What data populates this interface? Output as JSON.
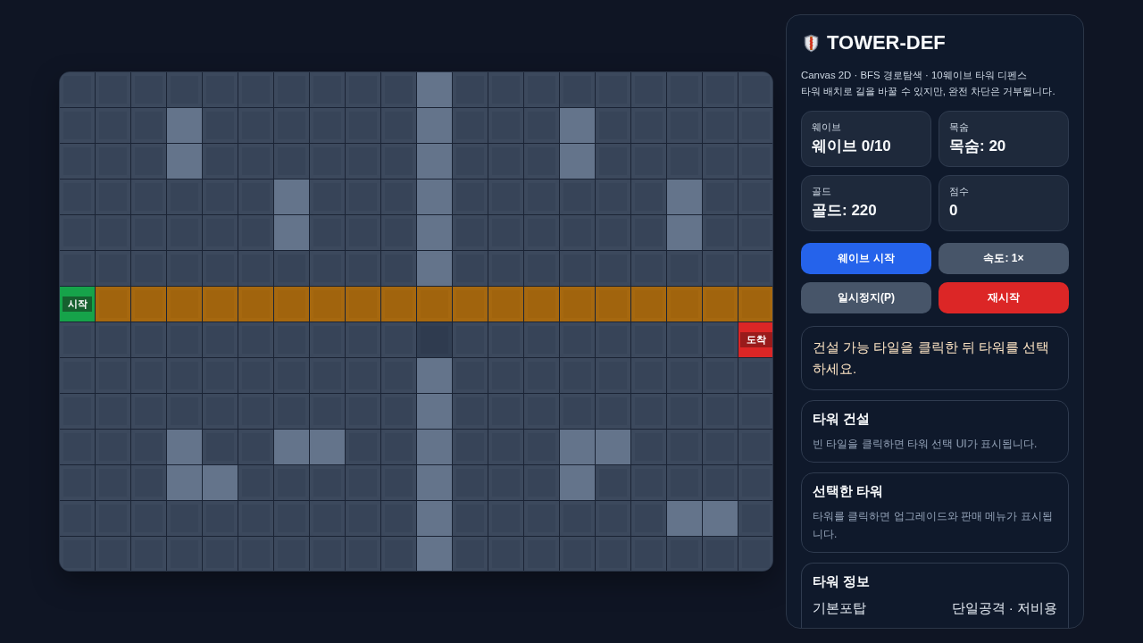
{
  "board": {
    "rows": [
      {
        "tiles": [
          {
            "kind": "floor"
          },
          {
            "kind": "floor"
          },
          {
            "kind": "floor"
          },
          {
            "kind": "floor"
          },
          {
            "kind": "floor"
          },
          {
            "kind": "floor"
          },
          {
            "kind": "floor"
          },
          {
            "kind": "floor"
          },
          {
            "kind": "floor"
          },
          {
            "kind": "floor"
          },
          {
            "kind": "wall"
          },
          {
            "kind": "floor"
          },
          {
            "kind": "floor"
          },
          {
            "kind": "floor"
          },
          {
            "kind": "floor"
          },
          {
            "kind": "floor"
          },
          {
            "kind": "floor"
          },
          {
            "kind": "floor"
          },
          {
            "kind": "floor"
          },
          {
            "kind": "floor"
          }
        ]
      },
      {
        "tiles": [
          {
            "kind": "floor"
          },
          {
            "kind": "floor"
          },
          {
            "kind": "floor"
          },
          {
            "kind": "wall"
          },
          {
            "kind": "floor"
          },
          {
            "kind": "floor"
          },
          {
            "kind": "floor"
          },
          {
            "kind": "floor"
          },
          {
            "kind": "floor"
          },
          {
            "kind": "floor"
          },
          {
            "kind": "wall"
          },
          {
            "kind": "floor"
          },
          {
            "kind": "floor"
          },
          {
            "kind": "floor"
          },
          {
            "kind": "wall"
          },
          {
            "kind": "floor"
          },
          {
            "kind": "floor"
          },
          {
            "kind": "floor"
          },
          {
            "kind": "floor"
          },
          {
            "kind": "floor"
          }
        ]
      },
      {
        "tiles": [
          {
            "kind": "floor"
          },
          {
            "kind": "floor"
          },
          {
            "kind": "floor"
          },
          {
            "kind": "wall"
          },
          {
            "kind": "floor"
          },
          {
            "kind": "floor"
          },
          {
            "kind": "floor"
          },
          {
            "kind": "floor"
          },
          {
            "kind": "floor"
          },
          {
            "kind": "floor"
          },
          {
            "kind": "wall"
          },
          {
            "kind": "floor"
          },
          {
            "kind": "floor"
          },
          {
            "kind": "floor"
          },
          {
            "kind": "wall"
          },
          {
            "kind": "floor"
          },
          {
            "kind": "floor"
          },
          {
            "kind": "floor"
          },
          {
            "kind": "floor"
          },
          {
            "kind": "floor"
          }
        ]
      },
      {
        "tiles": [
          {
            "kind": "floor"
          },
          {
            "kind": "floor"
          },
          {
            "kind": "floor"
          },
          {
            "kind": "floor"
          },
          {
            "kind": "floor"
          },
          {
            "kind": "floor"
          },
          {
            "kind": "wall"
          },
          {
            "kind": "floor"
          },
          {
            "kind": "floor"
          },
          {
            "kind": "floor"
          },
          {
            "kind": "wall"
          },
          {
            "kind": "floor"
          },
          {
            "kind": "floor"
          },
          {
            "kind": "floor"
          },
          {
            "kind": "floor"
          },
          {
            "kind": "floor"
          },
          {
            "kind": "floor"
          },
          {
            "kind": "wall"
          },
          {
            "kind": "floor"
          },
          {
            "kind": "floor"
          }
        ]
      },
      {
        "tiles": [
          {
            "kind": "floor"
          },
          {
            "kind": "floor"
          },
          {
            "kind": "floor"
          },
          {
            "kind": "floor"
          },
          {
            "kind": "floor"
          },
          {
            "kind": "floor"
          },
          {
            "kind": "wall"
          },
          {
            "kind": "floor"
          },
          {
            "kind": "floor"
          },
          {
            "kind": "floor"
          },
          {
            "kind": "wall"
          },
          {
            "kind": "floor"
          },
          {
            "kind": "floor"
          },
          {
            "kind": "floor"
          },
          {
            "kind": "floor"
          },
          {
            "kind": "floor"
          },
          {
            "kind": "floor"
          },
          {
            "kind": "wall"
          },
          {
            "kind": "floor"
          },
          {
            "kind": "floor"
          }
        ]
      },
      {
        "tiles": [
          {
            "kind": "floor"
          },
          {
            "kind": "floor"
          },
          {
            "kind": "floor"
          },
          {
            "kind": "floor"
          },
          {
            "kind": "floor"
          },
          {
            "kind": "floor"
          },
          {
            "kind": "floor"
          },
          {
            "kind": "floor"
          },
          {
            "kind": "floor"
          },
          {
            "kind": "floor"
          },
          {
            "kind": "wall"
          },
          {
            "kind": "floor"
          },
          {
            "kind": "floor"
          },
          {
            "kind": "floor"
          },
          {
            "kind": "floor"
          },
          {
            "kind": "floor"
          },
          {
            "kind": "floor"
          },
          {
            "kind": "floor"
          },
          {
            "kind": "floor"
          },
          {
            "kind": "floor"
          }
        ]
      },
      {
        "tiles": [
          {
            "kind": "start",
            "label": "시작"
          },
          {
            "kind": "path"
          },
          {
            "kind": "path"
          },
          {
            "kind": "path"
          },
          {
            "kind": "path"
          },
          {
            "kind": "path"
          },
          {
            "kind": "path"
          },
          {
            "kind": "path"
          },
          {
            "kind": "path"
          },
          {
            "kind": "path"
          },
          {
            "kind": "path"
          },
          {
            "kind": "path"
          },
          {
            "kind": "path"
          },
          {
            "kind": "path"
          },
          {
            "kind": "path"
          },
          {
            "kind": "path"
          },
          {
            "kind": "path"
          },
          {
            "kind": "path"
          },
          {
            "kind": "path"
          },
          {
            "kind": "path"
          }
        ]
      },
      {
        "tiles": [
          {
            "kind": "floor"
          },
          {
            "kind": "floor"
          },
          {
            "kind": "floor"
          },
          {
            "kind": "floor"
          },
          {
            "kind": "floor"
          },
          {
            "kind": "floor"
          },
          {
            "kind": "floor"
          },
          {
            "kind": "floor"
          },
          {
            "kind": "floor"
          },
          {
            "kind": "floor"
          },
          {
            "kind": "dim"
          },
          {
            "kind": "floor"
          },
          {
            "kind": "floor"
          },
          {
            "kind": "floor"
          },
          {
            "kind": "floor"
          },
          {
            "kind": "floor"
          },
          {
            "kind": "floor"
          },
          {
            "kind": "floor"
          },
          {
            "kind": "floor"
          },
          {
            "kind": "end",
            "label": "도착"
          }
        ]
      },
      {
        "tiles": [
          {
            "kind": "floor"
          },
          {
            "kind": "floor"
          },
          {
            "kind": "floor"
          },
          {
            "kind": "floor"
          },
          {
            "kind": "floor"
          },
          {
            "kind": "floor"
          },
          {
            "kind": "floor"
          },
          {
            "kind": "floor"
          },
          {
            "kind": "floor"
          },
          {
            "kind": "floor"
          },
          {
            "kind": "wall"
          },
          {
            "kind": "floor"
          },
          {
            "kind": "floor"
          },
          {
            "kind": "floor"
          },
          {
            "kind": "floor"
          },
          {
            "kind": "floor"
          },
          {
            "kind": "floor"
          },
          {
            "kind": "floor"
          },
          {
            "kind": "floor"
          },
          {
            "kind": "floor"
          }
        ]
      },
      {
        "tiles": [
          {
            "kind": "floor"
          },
          {
            "kind": "floor"
          },
          {
            "kind": "floor"
          },
          {
            "kind": "floor"
          },
          {
            "kind": "floor"
          },
          {
            "kind": "floor"
          },
          {
            "kind": "floor"
          },
          {
            "kind": "floor"
          },
          {
            "kind": "floor"
          },
          {
            "kind": "floor"
          },
          {
            "kind": "wall"
          },
          {
            "kind": "floor"
          },
          {
            "kind": "floor"
          },
          {
            "kind": "floor"
          },
          {
            "kind": "floor"
          },
          {
            "kind": "floor"
          },
          {
            "kind": "floor"
          },
          {
            "kind": "floor"
          },
          {
            "kind": "floor"
          },
          {
            "kind": "floor"
          }
        ]
      },
      {
        "tiles": [
          {
            "kind": "floor"
          },
          {
            "kind": "floor"
          },
          {
            "kind": "floor"
          },
          {
            "kind": "wall"
          },
          {
            "kind": "floor"
          },
          {
            "kind": "floor"
          },
          {
            "kind": "wall"
          },
          {
            "kind": "wall"
          },
          {
            "kind": "floor"
          },
          {
            "kind": "floor"
          },
          {
            "kind": "wall"
          },
          {
            "kind": "floor"
          },
          {
            "kind": "floor"
          },
          {
            "kind": "floor"
          },
          {
            "kind": "wall"
          },
          {
            "kind": "wall"
          },
          {
            "kind": "floor"
          },
          {
            "kind": "floor"
          },
          {
            "kind": "floor"
          },
          {
            "kind": "floor"
          }
        ]
      },
      {
        "tiles": [
          {
            "kind": "floor"
          },
          {
            "kind": "floor"
          },
          {
            "kind": "floor"
          },
          {
            "kind": "wall"
          },
          {
            "kind": "wall"
          },
          {
            "kind": "floor"
          },
          {
            "kind": "floor"
          },
          {
            "kind": "floor"
          },
          {
            "kind": "floor"
          },
          {
            "kind": "floor"
          },
          {
            "kind": "wall"
          },
          {
            "kind": "floor"
          },
          {
            "kind": "floor"
          },
          {
            "kind": "floor"
          },
          {
            "kind": "wall"
          },
          {
            "kind": "floor"
          },
          {
            "kind": "floor"
          },
          {
            "kind": "floor"
          },
          {
            "kind": "floor"
          },
          {
            "kind": "floor"
          }
        ]
      },
      {
        "tiles": [
          {
            "kind": "floor"
          },
          {
            "kind": "floor"
          },
          {
            "kind": "floor"
          },
          {
            "kind": "floor"
          },
          {
            "kind": "floor"
          },
          {
            "kind": "floor"
          },
          {
            "kind": "floor"
          },
          {
            "kind": "floor"
          },
          {
            "kind": "floor"
          },
          {
            "kind": "floor"
          },
          {
            "kind": "wall"
          },
          {
            "kind": "floor"
          },
          {
            "kind": "floor"
          },
          {
            "kind": "floor"
          },
          {
            "kind": "floor"
          },
          {
            "kind": "floor"
          },
          {
            "kind": "floor"
          },
          {
            "kind": "wall"
          },
          {
            "kind": "wall"
          },
          {
            "kind": "floor"
          }
        ]
      },
      {
        "tiles": [
          {
            "kind": "floor"
          },
          {
            "kind": "floor"
          },
          {
            "kind": "floor"
          },
          {
            "kind": "floor"
          },
          {
            "kind": "floor"
          },
          {
            "kind": "floor"
          },
          {
            "kind": "floor"
          },
          {
            "kind": "floor"
          },
          {
            "kind": "floor"
          },
          {
            "kind": "floor"
          },
          {
            "kind": "wall"
          },
          {
            "kind": "floor"
          },
          {
            "kind": "floor"
          },
          {
            "kind": "floor"
          },
          {
            "kind": "floor"
          },
          {
            "kind": "floor"
          },
          {
            "kind": "floor"
          },
          {
            "kind": "floor"
          },
          {
            "kind": "floor"
          },
          {
            "kind": "floor"
          }
        ]
      }
    ]
  },
  "panel": {
    "title": "TOWER-DEF",
    "subtitle_lines": [
      "Canvas 2D · BFS 경로탐색 · 10웨이브 타워 디펜스",
      "타워 배치로 길을 바꿀 수 있지만, 완전 차단은 거부됩니다."
    ],
    "stats": [
      {
        "label": "웨이브",
        "value": "웨이브 0/10"
      },
      {
        "label": "목숨",
        "value": "목숨: 20"
      },
      {
        "label": "골드",
        "value": "골드: 220"
      },
      {
        "label": "점수",
        "value": "0"
      }
    ],
    "buttons": [
      {
        "label": "웨이브 시작",
        "kind": "primary"
      },
      {
        "label": "속도: 1×",
        "kind": "secondary"
      },
      {
        "label": "일시정지(P)",
        "kind": "secondary"
      },
      {
        "label": "재시작",
        "kind": "danger"
      }
    ],
    "message": "건설 가능 타일을 클릭한 뒤 타워를 선택하세요.",
    "cards": [
      {
        "title": "타워 건설",
        "text": "빈 타일을 클릭하면 타워 선택 UI가 표시됩니다."
      },
      {
        "title": "선택한 타워",
        "text": "타워를 클릭하면 업그레이드와 판매 메뉴가 표시됩니다."
      }
    ],
    "tower_info": {
      "title": "타워 정보",
      "rows": [
        {
          "name": "기본포탑",
          "description": "단일공격 · 저비용"
        }
      ]
    }
  }
}
